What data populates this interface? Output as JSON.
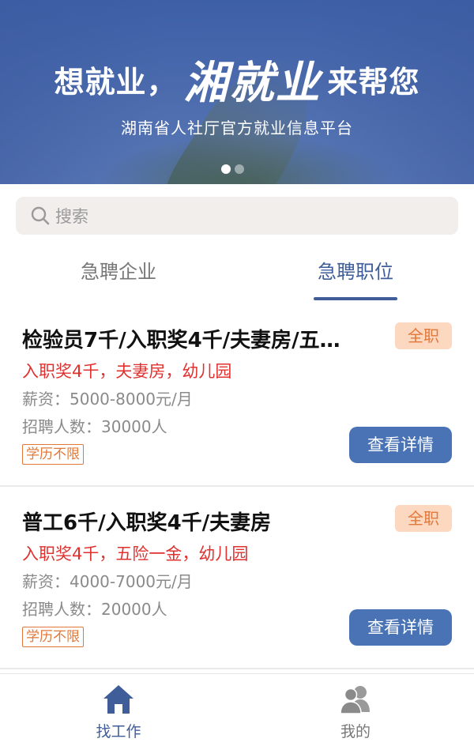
{
  "banner": {
    "headline_pre": "想就业，",
    "headline_brand": "湘就业",
    "headline_post": "来帮您",
    "subtitle": "湖南省人社厅官方就业信息平台",
    "slides_total": 2,
    "slide_active": 1
  },
  "search": {
    "placeholder": "搜索",
    "icon": "search-icon"
  },
  "tabs": [
    {
      "label": "急聘企业",
      "active": false
    },
    {
      "label": "急聘职位",
      "active": true
    }
  ],
  "jobs": [
    {
      "title": "检验员7千/入职奖4千/夫妻房/五…",
      "type": "全职",
      "perks": "入职奖4千，夫妻房，幼儿园",
      "salary": "薪资：5000-8000元/月",
      "headcount": "招聘人数：30000人",
      "education": "学历不限",
      "detail_label": "查看详情"
    },
    {
      "title": "普工6千/入职奖4千/夫妻房",
      "type": "全职",
      "perks": "入职奖4千，五险一金，幼儿园",
      "salary": "薪资：4000-7000元/月",
      "headcount": "招聘人数：20000人",
      "education": "学历不限",
      "detail_label": "查看详情"
    }
  ],
  "nav": [
    {
      "label": "找工作",
      "icon": "home-icon",
      "active": true
    },
    {
      "label": "我的",
      "icon": "users-icon",
      "active": false
    }
  ],
  "colors": {
    "primary": "#3e5d99",
    "button": "#4a73b6",
    "accent_orange": "#e2783a",
    "perk_red": "#e0312f"
  }
}
